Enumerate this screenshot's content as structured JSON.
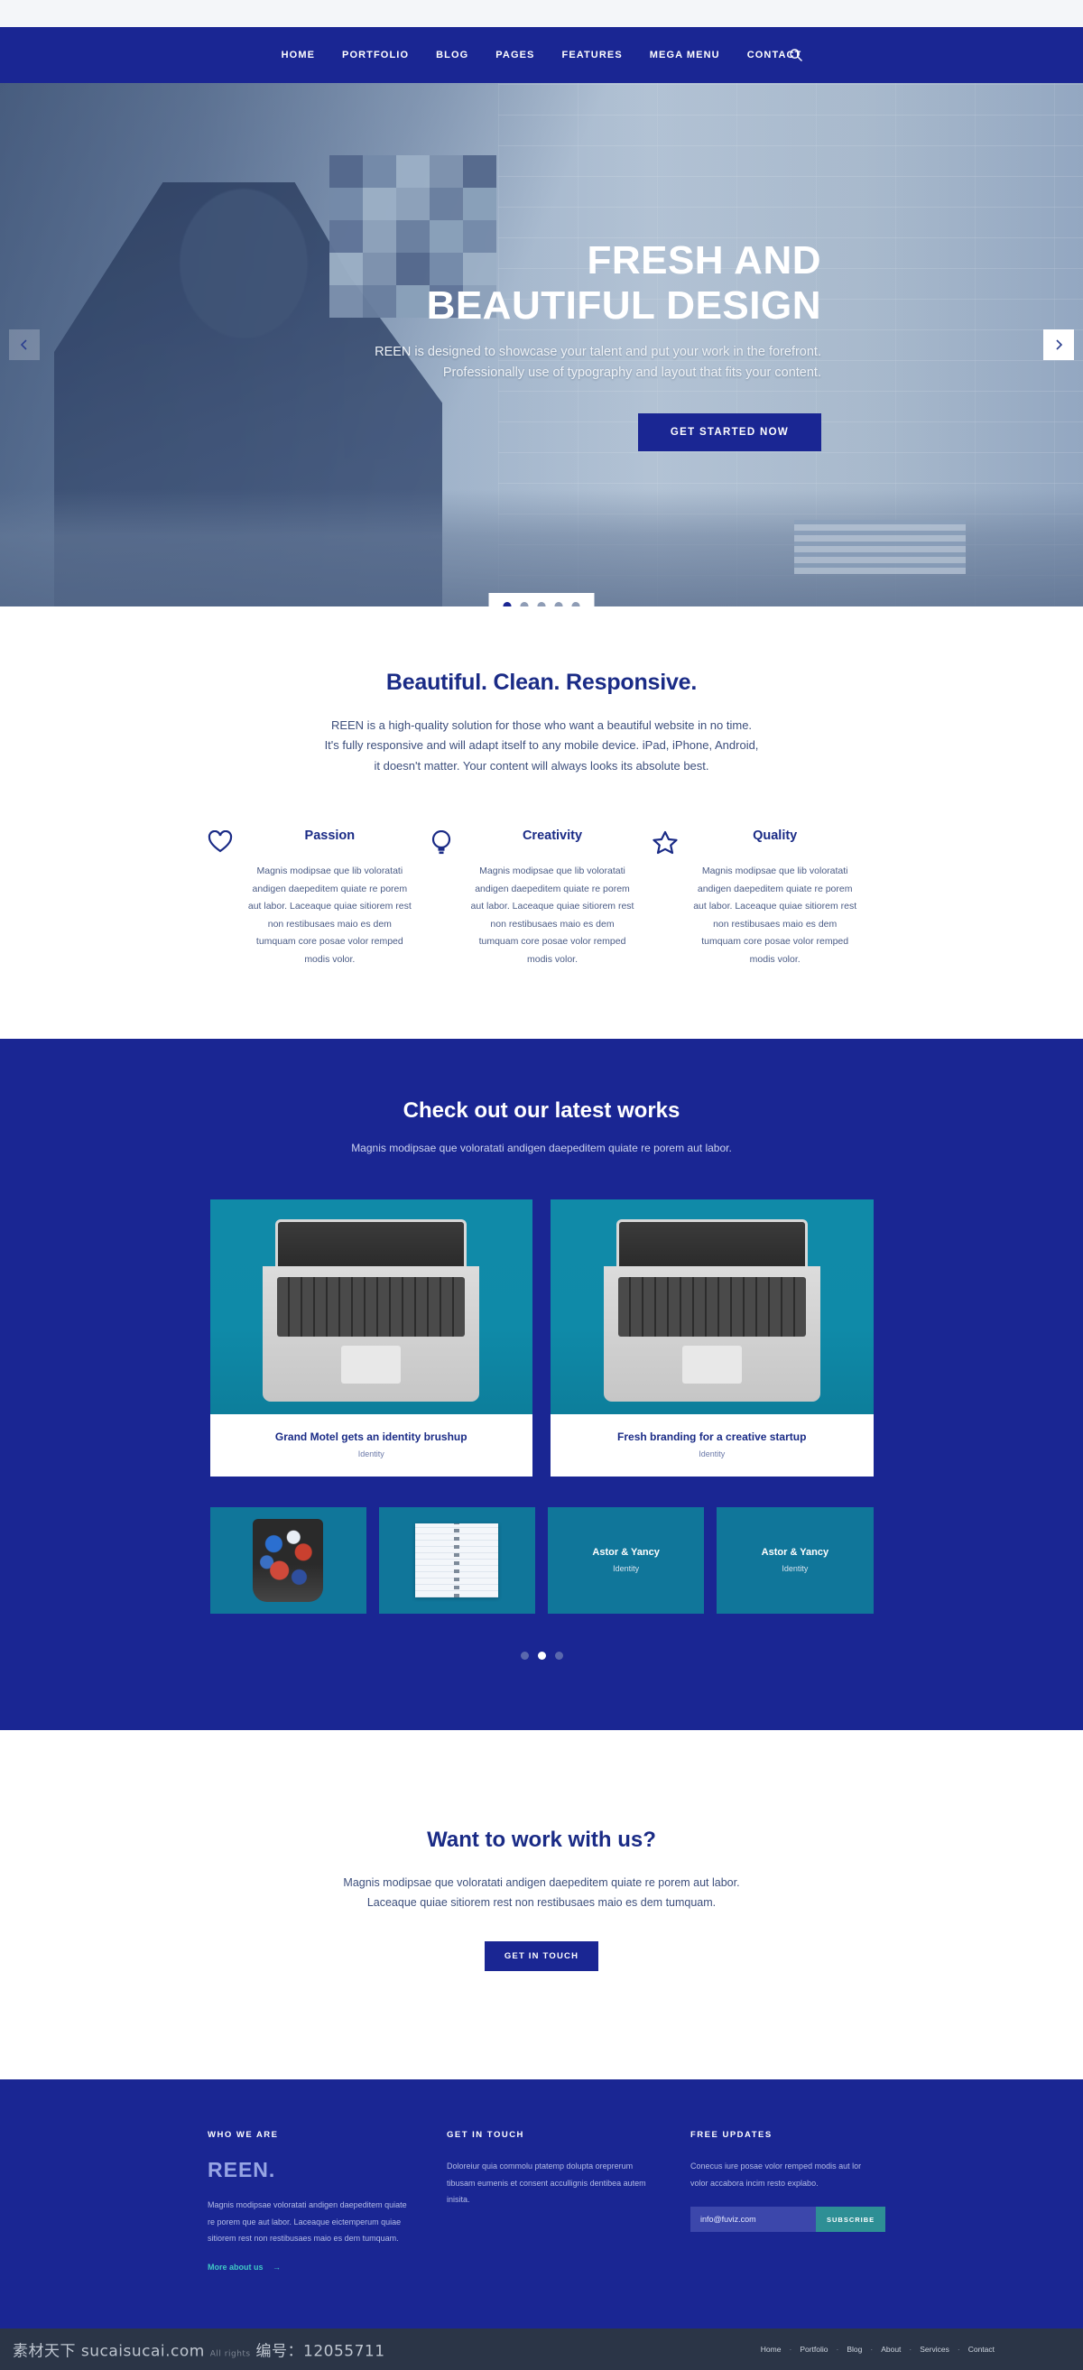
{
  "nav": {
    "items": [
      "HOME",
      "PORTFOLIO",
      "BLOG",
      "PAGES",
      "FEATURES",
      "MEGA MENU",
      "CONTACT"
    ],
    "search_icon": "search-icon"
  },
  "hero": {
    "title_line1": "FRESH AND",
    "title_line2": "BEAUTIFUL DESIGN",
    "sub_line1": "REEN is designed to showcase your talent and put your work in the forefront.",
    "sub_line2": "Professionally use of typography and layout that fits your content.",
    "button": "GET STARTED NOW",
    "prev_icon": "chevron-left-icon",
    "next_icon": "chevron-right-icon",
    "slide_count": 5,
    "active_slide": 1
  },
  "intro": {
    "heading": "Beautiful. Clean. Responsive.",
    "line1": "REEN is a high-quality solution for those who want a beautiful website in no time.",
    "line2": "It's fully responsive and will adapt itself to any mobile device. iPad, iPhone, Android,",
    "line3": "it doesn't matter. Your content will always looks its absolute best.",
    "features": [
      {
        "icon": "heart-icon",
        "title": "Passion",
        "body": "Magnis modipsae que lib voloratati andigen daepeditem quiate re porem aut labor. Laceaque quiae sitiorem rest non restibusaes maio es dem tumquam core posae volor remped modis volor."
      },
      {
        "icon": "lightbulb-icon",
        "title": "Creativity",
        "body": "Magnis modipsae que lib voloratati andigen daepeditem quiate re porem aut labor. Laceaque quiae sitiorem rest non restibusaes maio es dem tumquam core posae volor remped modis volor."
      },
      {
        "icon": "star-icon",
        "title": "Quality",
        "body": "Magnis modipsae que lib voloratati andigen daepeditem quiate re porem aut labor. Laceaque quiae sitiorem rest non restibusaes maio es dem tumquam core posae volor remped modis volor."
      }
    ]
  },
  "portfolio": {
    "heading": "Check out our latest works",
    "lead": "Magnis modipsae que voloratati andigen daepeditem quiate re porem aut labor.",
    "big_cards": [
      {
        "title": "Grand Motel gets an identity brushup",
        "category": "Identity",
        "thumb": "laptop-photo"
      },
      {
        "title": "Fresh branding for a creative startup",
        "category": "Identity",
        "thumb": "laptop-photo"
      }
    ],
    "small_cards": [
      {
        "title": "",
        "category": "",
        "thumb": "pen-cup-photo"
      },
      {
        "title": "",
        "category": "",
        "thumb": "notebook-photo"
      },
      {
        "title": "Astor & Yancy",
        "category": "Identity",
        "thumb": "none"
      },
      {
        "title": "Astor & Yancy",
        "category": "Identity",
        "thumb": "none"
      }
    ],
    "dot_count": 3,
    "active_dot": 2
  },
  "cta": {
    "heading": "Want to work with us?",
    "line1": "Magnis modipsae que voloratati andigen daepeditem quiate re porem aut labor.",
    "line2": "Laceaque quiae sitiorem rest non restibusaes maio es dem tumquam.",
    "button": "GET IN TOUCH"
  },
  "footer": {
    "col1": {
      "heading": "WHO WE ARE",
      "brand": "REEN.",
      "body": "Magnis modipsae voloratati andigen daepeditem quiate re porem que aut labor. Laceaque eictemperum quiae sitiorem rest non restibusaes maio es dem tumquam.",
      "link": "More about us",
      "link_arrow": "→"
    },
    "col2": {
      "heading": "GET IN TOUCH",
      "body": "Doloreiur quia commolu ptatemp dolupta oreprerum tibusam eumenis et consent accullignis dentibea autem inisita."
    },
    "col3": {
      "heading": "FREE UPDATES",
      "body": "Conecus iure posae volor remped modis aut lor volor accabora incim resto explabo.",
      "email_value": "info@fuviz.com",
      "email_placeholder": "info@fuviz.com",
      "button": "SUBSCRIBE"
    }
  },
  "bottombar": {
    "links": [
      "Home",
      "Portfolio",
      "Blog",
      "About",
      "Services",
      "Contact"
    ],
    "separator": "·",
    "watermark_main": "素材天下 sucaisucai.com",
    "watermark_id": "编号：12055711",
    "watermark_small": "All rights"
  },
  "colors": {
    "brand_blue": "#1a2693",
    "heading_blue": "#1a2b86",
    "teal": "#2e8f95",
    "accent_teal": "#3fc9c4",
    "thumb_teal": "#108aa8",
    "bottombar": "#2b3547"
  }
}
